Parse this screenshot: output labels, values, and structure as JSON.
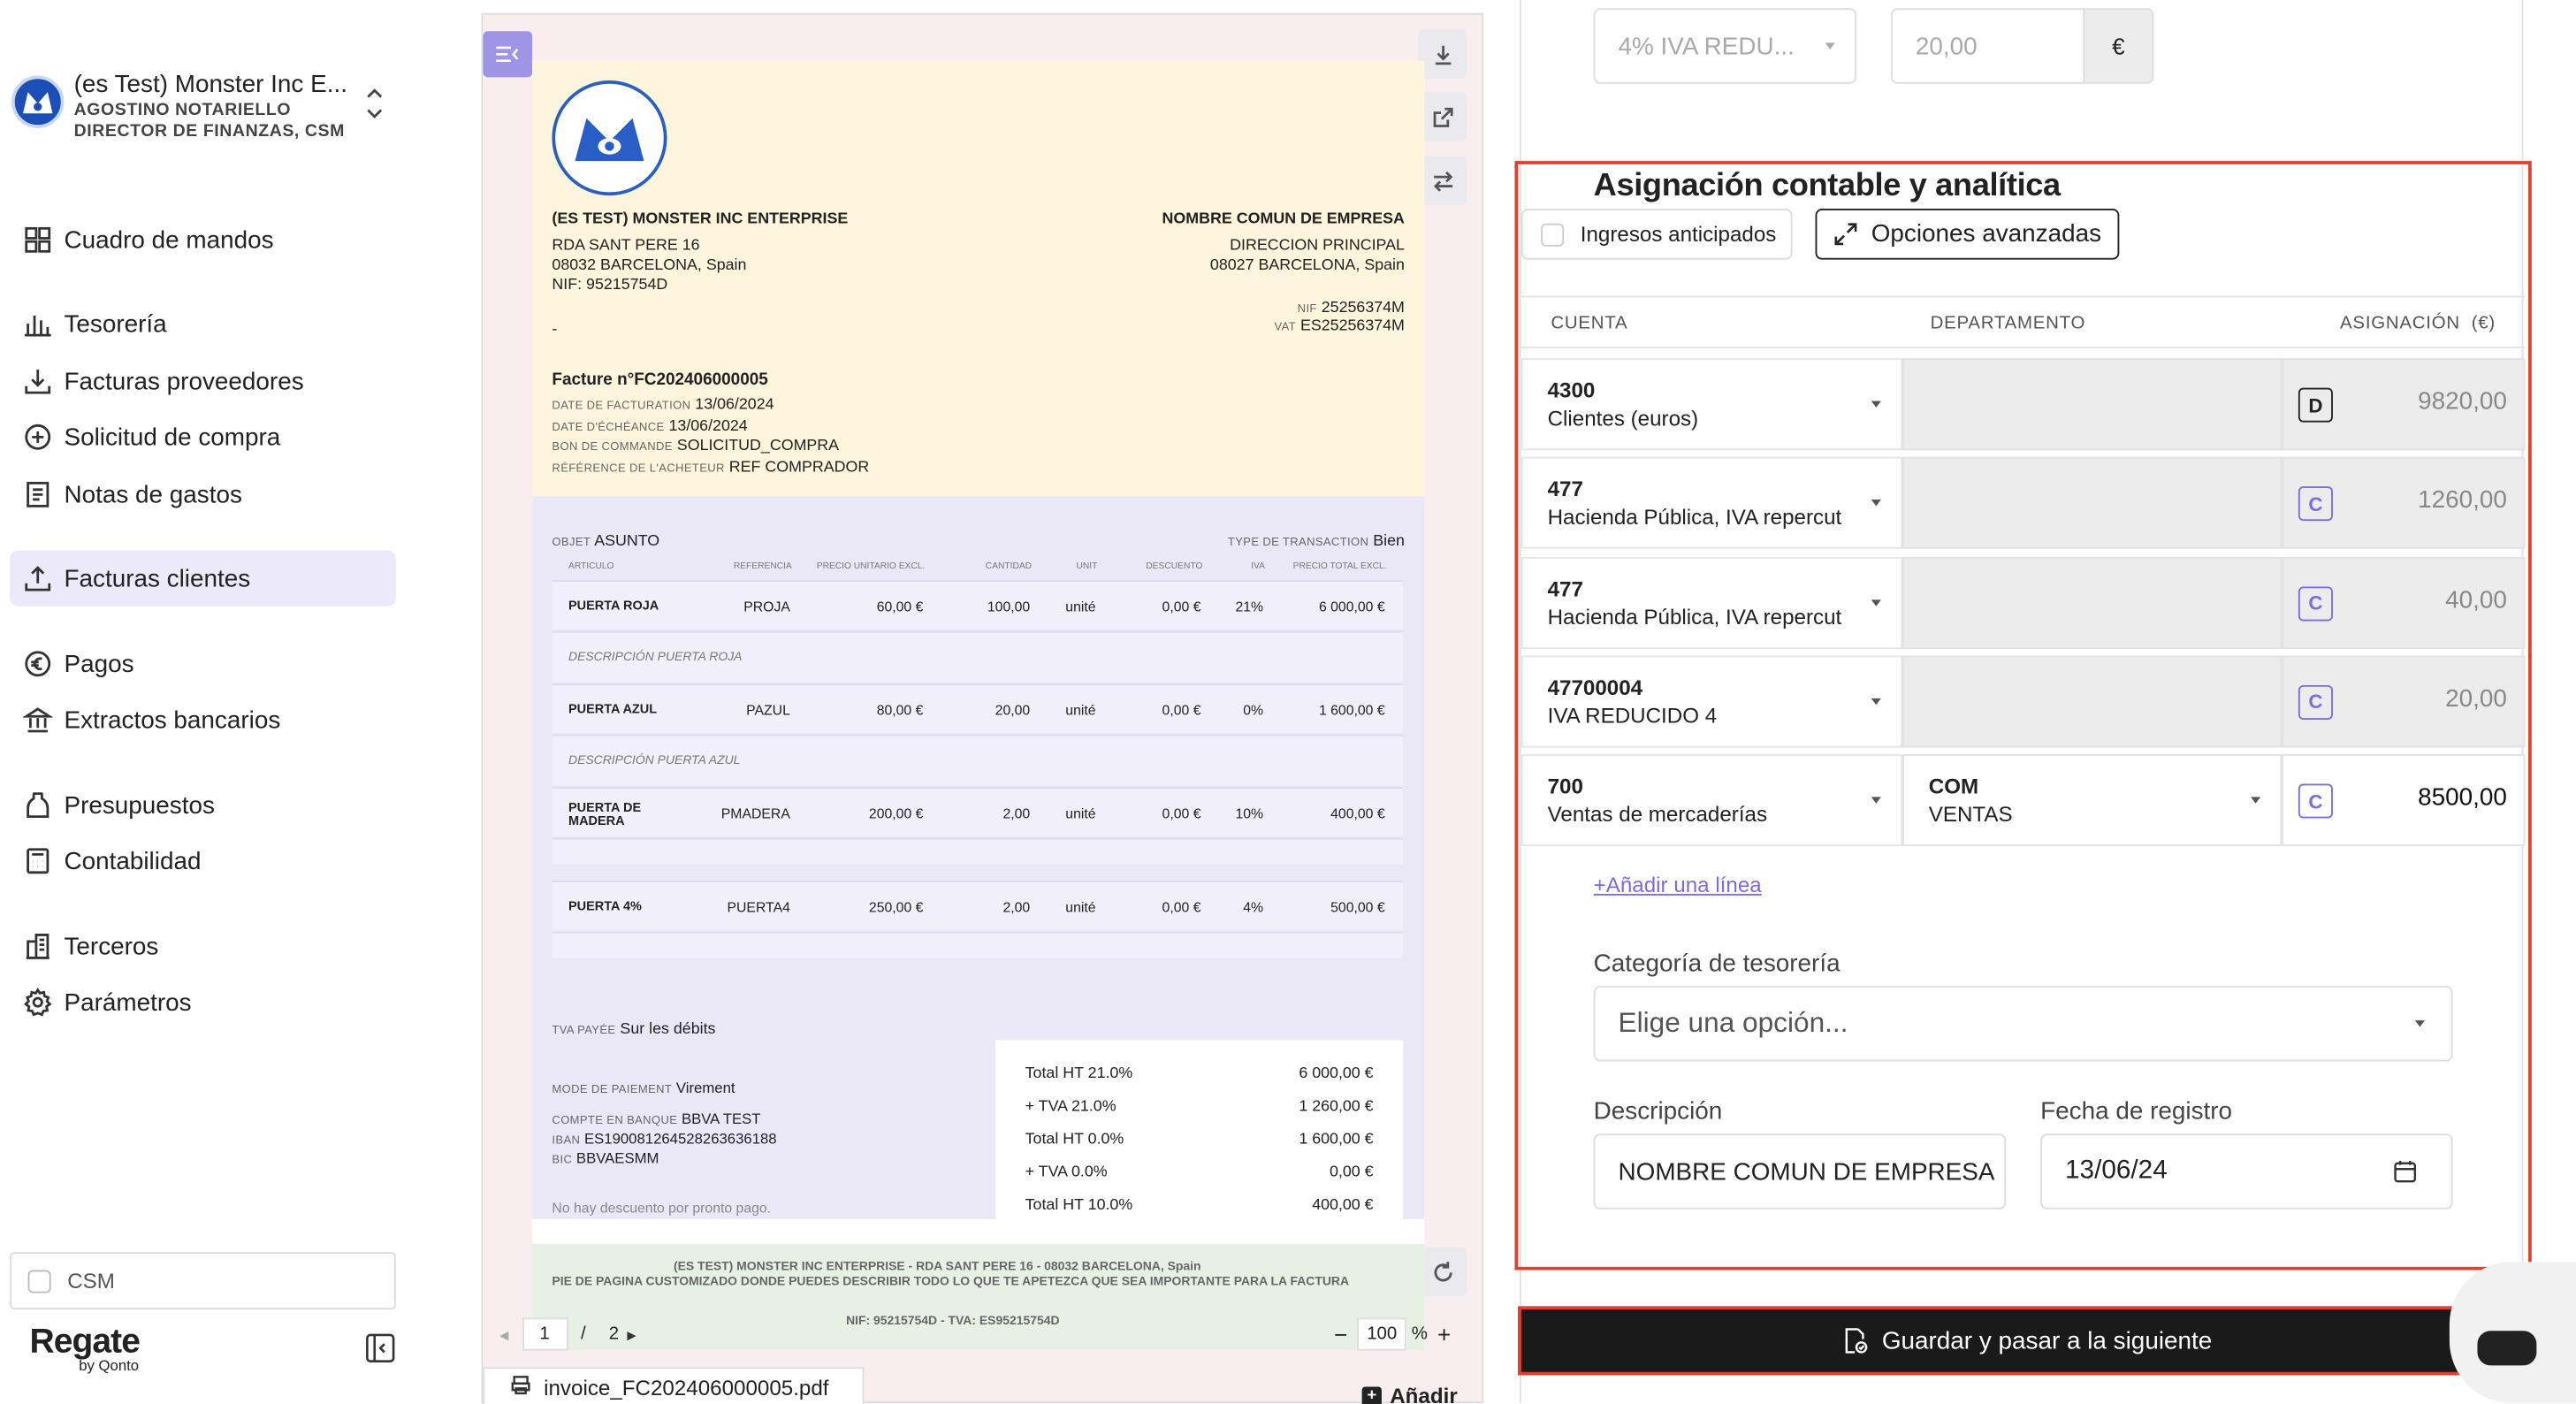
{
  "org": {
    "name": "(es Test) Monster Inc E...",
    "user": "AGOSTINO NOTARIELLO",
    "role": "DIRECTOR DE FINANZAS, CSM"
  },
  "nav": [
    {
      "label": "Cuadro de mandos",
      "icon": "dashboard-icon"
    },
    {
      "label": "Tesorería",
      "icon": "bar-chart-icon"
    },
    {
      "label": "Facturas proveedores",
      "icon": "download-icon"
    },
    {
      "label": "Solicitud de compra",
      "icon": "plus-circle-icon"
    },
    {
      "label": "Notas de gastos",
      "icon": "receipt-icon"
    },
    {
      "label": "Facturas clientes",
      "icon": "upload-icon"
    },
    {
      "label": "Pagos",
      "icon": "euro-icon"
    },
    {
      "label": "Extractos bancarios",
      "icon": "bank-icon"
    },
    {
      "label": "Presupuestos",
      "icon": "jar-icon"
    },
    {
      "label": "Contabilidad",
      "icon": "calculator-icon"
    },
    {
      "label": "Terceros",
      "icon": "building-icon"
    },
    {
      "label": "Parámetros",
      "icon": "gear-icon"
    }
  ],
  "sidebar_footer": {
    "checkbox_label": "CSM",
    "brand": "Regate",
    "brand_sub": "by Qonto"
  },
  "viewer": {
    "page_current": "1",
    "page_sep": "/",
    "page_total": "2",
    "zoom": "100",
    "zoom_unit": "%",
    "file_name": "invoice_FC202406000005.pdf",
    "add_label": "Añadir"
  },
  "invoice": {
    "seller_name": "(ES TEST) MONSTER INC ENTERPRISE",
    "seller_addr1": "RDA SANT PERE 16",
    "seller_addr2": "08032 BARCELONA, Spain",
    "seller_nif": "NIF: 95215754D",
    "seller_dash": "-",
    "buyer_name": "NOMBRE COMUN DE EMPRESA",
    "buyer_addr1": "DIRECCION PRINCIPAL",
    "buyer_addr2": "08027 BARCELONA, Spain",
    "buyer_nif_label": "NIF",
    "buyer_nif": "25256374M",
    "buyer_vat_label": "VAT",
    "buyer_vat": "ES25256374M",
    "title": "Facture n°FC202406000005",
    "fields": [
      {
        "label": "DATE DE FACTURATION",
        "value": "13/06/2024"
      },
      {
        "label": "DATE D'ÉCHÉANCE",
        "value": "13/06/2024"
      },
      {
        "label": "BON DE COMMANDE",
        "value": "SOLICITUD_COMPRA"
      },
      {
        "label": "RÉFÉRENCE DE L'ACHETEUR",
        "value": "REF COMPRADOR"
      }
    ],
    "object_label": "OBJET",
    "object_value": "ASUNTO",
    "tx_label": "TYPE DE TRANSACTION",
    "tx_value": "Bien",
    "columns": [
      "ARTICULO",
      "REFERENCIA",
      "PRECIO UNITARIO EXCL.",
      "CANTIDAD",
      "UNIT",
      "DESCUENTO",
      "IVA",
      "PRECIO TOTAL EXCL."
    ],
    "lines": [
      {
        "name": "PUERTA ROJA",
        "ref": "PROJA",
        "price": "60,00 €",
        "qty": "100,00",
        "unit": "unité",
        "disc": "0,00 €",
        "vat": "21%",
        "total": "6 000,00 €",
        "desc": "DESCRIPCIÓN PUERTA ROJA"
      },
      {
        "name": "PUERTA AZUL",
        "ref": "PAZUL",
        "price": "80,00 €",
        "qty": "20,00",
        "unit": "unité",
        "disc": "0,00 €",
        "vat": "0%",
        "total": "1 600,00 €",
        "desc": "DESCRIPCIÓN PUERTA AZUL"
      },
      {
        "name": "PUERTA DE MADERA",
        "ref": "PMADERA",
        "price": "200,00 €",
        "qty": "2,00",
        "unit": "unité",
        "disc": "0,00 €",
        "vat": "10%",
        "total": "400,00 €",
        "desc": ""
      },
      {
        "name": "PUERTA 4%",
        "ref": "PUERTA4",
        "price": "250,00 €",
        "qty": "2,00",
        "unit": "unité",
        "disc": "0,00 €",
        "vat": "4%",
        "total": "500,00 €",
        "desc": ""
      }
    ],
    "tva_label": "TVA PAYÉE",
    "tva_value": "Sur les débits",
    "payment": [
      {
        "label": "MODE DE PAIEMENT",
        "value": "Virement"
      },
      {
        "label": "COMPTE EN BANQUE",
        "value": "BBVA TEST"
      },
      {
        "label": "IBAN",
        "value": "ES19008126452826363618​8"
      },
      {
        "label": "BIC",
        "value": "BBVAESMM"
      }
    ],
    "no_discount": "No hay descuento por pronto pago.",
    "totals": [
      {
        "label": "Total HT 21.0%",
        "value": "6 000,00 €"
      },
      {
        "label": "+ TVA 21.0%",
        "value": "1 260,00 €"
      },
      {
        "label": "Total HT 0.0%",
        "value": "1 600,00 €"
      },
      {
        "label": "+ TVA 0.0%",
        "value": "0,00 €"
      },
      {
        "label": "Total HT 10.0%",
        "value": "400,00 €"
      }
    ],
    "footer1": "(ES TEST) MONSTER INC ENTERPRISE - RDA SANT PERE 16 - 08032 BARCELONA, Spain",
    "footer2": "PIE DE PAGINA CUSTOMIZADO DONDE PUEDES DESCRIBIR TODO LO QUE TE APETEZCA QUE SEA IMPORTANTE PARA LA FACTURA",
    "footer3": "NIF: 95215754D - TVA: ES95215754D"
  },
  "form": {
    "vat_select": "4% IVA REDU...",
    "vat_amount": "20,00",
    "currency": "€",
    "section_title": "Asignación contable y analítica",
    "advance_label": "Ingresos anticipados",
    "advanced_btn": "Opciones avanzadas",
    "col_account": "CUENTA",
    "col_dept": "DEPARTAMENTO",
    "col_amount": "ASIGNACIÓN  (€)",
    "rows": [
      {
        "code": "4300",
        "name": "Clientes (euros)",
        "dept_code": "",
        "dept_name": "",
        "side": "D",
        "amount": "9820,00"
      },
      {
        "code": "477",
        "name": "Hacienda Pública, IVA repercut",
        "dept_code": "",
        "dept_name": "",
        "side": "C",
        "amount": "1260,00"
      },
      {
        "code": "477",
        "name": "Hacienda Pública, IVA repercut",
        "dept_code": "",
        "dept_name": "",
        "side": "C",
        "amount": "40,00"
      },
      {
        "code": "47700004",
        "name": "IVA REDUCIDO 4",
        "dept_code": "",
        "dept_name": "",
        "side": "C",
        "amount": "20,00"
      },
      {
        "code": "700",
        "name": "Ventas de mercaderías",
        "dept_code": "COM",
        "dept_name": "VENTAS",
        "side": "C",
        "amount": "8500,00"
      }
    ],
    "add_line": "+Añadir una línea",
    "treasury_label": "Categoría de tesorería",
    "treasury_placeholder": "Elige una opción...",
    "desc_label": "Descripción",
    "desc_value": "NOMBRE COMUN DE EMPRESA",
    "date_label": "Fecha de registro",
    "date_value": "13/06/24",
    "save_btn": "Guardar y pasar a la siguiente"
  }
}
